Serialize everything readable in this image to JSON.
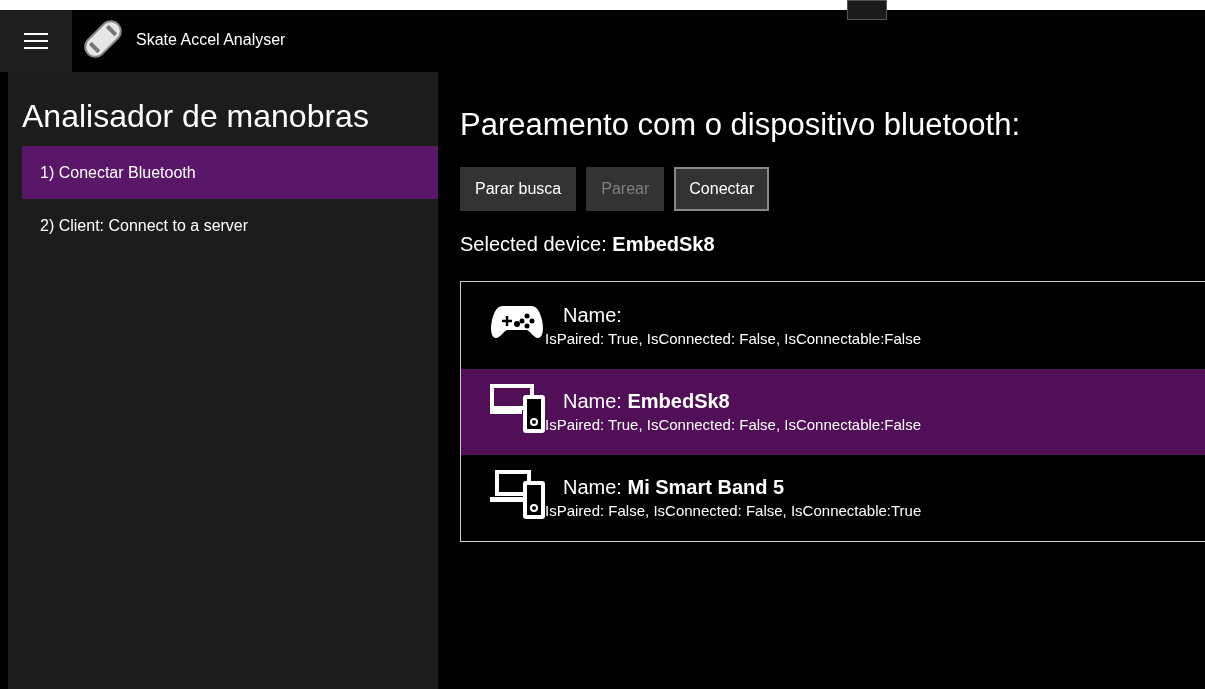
{
  "app": {
    "title": "Skate Accel Analyser"
  },
  "sidebar": {
    "title": "Analisador de manobras",
    "items": [
      {
        "label": "1) Conectar Bluetooth",
        "selected": true
      },
      {
        "label": "2) Client: Connect to a server",
        "selected": false
      }
    ]
  },
  "main": {
    "heading": "Pareamento com o dispositivo bluetooth:",
    "buttons": [
      {
        "label": "Parar busca",
        "disabled": false,
        "focused": false
      },
      {
        "label": "Parear",
        "disabled": true,
        "focused": false
      },
      {
        "label": "Conectar",
        "disabled": false,
        "focused": true
      }
    ],
    "selected_device": "Selected device: **EmbedSk8**",
    "devices": [
      {
        "kind": "gamepad",
        "name": "Name:",
        "status": "IsPaired: True, IsConnected: False, IsConnectable:False",
        "selected": false
      },
      {
        "kind": "devices",
        "name": "Name: **EmbedSk8**",
        "status": "IsPaired: True, IsConnected: False, IsConnectable:False",
        "selected": true
      },
      {
        "kind": "laptop",
        "name": "Name: **Mi Smart Band 5**",
        "status": "IsPaired: False, IsConnected: False, IsConnectable:True",
        "selected": false
      }
    ]
  }
}
